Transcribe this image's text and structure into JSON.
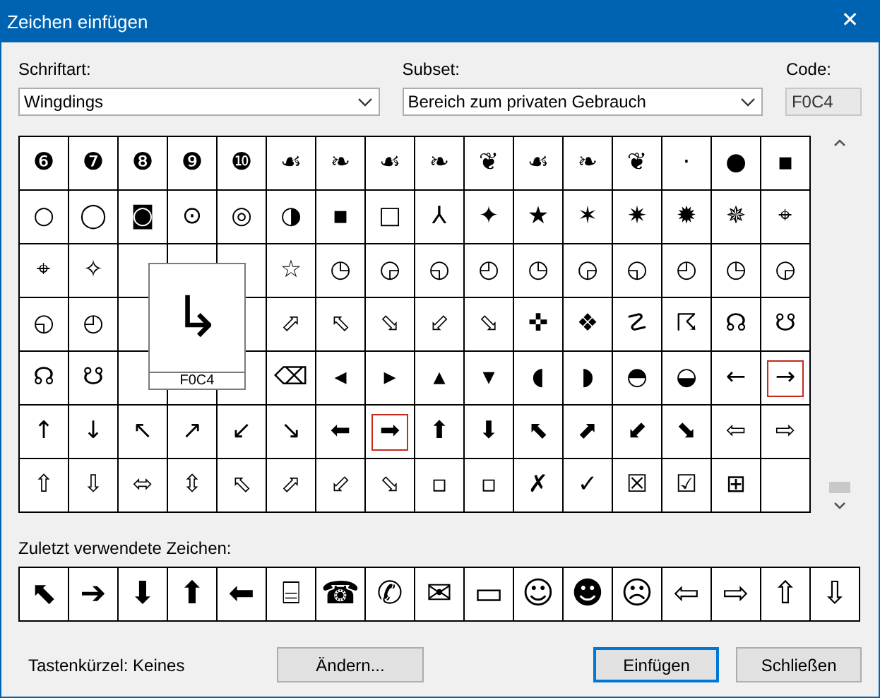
{
  "window": {
    "title": "Zeichen einfügen",
    "close": "✕"
  },
  "font": {
    "label": "Schriftart:",
    "value": "Wingdings"
  },
  "subset": {
    "label": "Subset:",
    "value": "Bereich zum privaten Gebrauch"
  },
  "code": {
    "label": "Code:",
    "value": "F0C4"
  },
  "grid": [
    {
      "cells": [
        {
          "symbol": "❻",
          "selected": false
        },
        {
          "symbol": "❼",
          "selected": false
        },
        {
          "symbol": "❽",
          "selected": false
        },
        {
          "symbol": "❾",
          "selected": false
        },
        {
          "symbol": "❿",
          "selected": false
        },
        {
          "symbol": "☙",
          "selected": false
        },
        {
          "symbol": "❧",
          "selected": false
        },
        {
          "symbol": "☙",
          "selected": false
        },
        {
          "symbol": "❧",
          "selected": false
        },
        {
          "symbol": "❦",
          "selected": false
        },
        {
          "symbol": "☙",
          "selected": false
        },
        {
          "symbol": "❧",
          "selected": false
        },
        {
          "symbol": "❦",
          "selected": false
        },
        {
          "symbol": "·",
          "selected": false
        },
        {
          "symbol": "●",
          "selected": false
        },
        {
          "symbol": "▪",
          "selected": false
        }
      ]
    },
    {
      "cells": [
        {
          "symbol": "○",
          "selected": false
        },
        {
          "symbol": "◯",
          "selected": false
        },
        {
          "symbol": "◙",
          "selected": false
        },
        {
          "symbol": "⊙",
          "selected": false
        },
        {
          "symbol": "◎",
          "selected": false
        },
        {
          "symbol": "◑",
          "selected": false
        },
        {
          "symbol": "▪",
          "selected": false
        },
        {
          "symbol": "□",
          "selected": false
        },
        {
          "symbol": "⅄",
          "selected": false
        },
        {
          "symbol": "✦",
          "selected": false
        },
        {
          "symbol": "★",
          "selected": false
        },
        {
          "symbol": "✶",
          "selected": false
        },
        {
          "symbol": "✷",
          "selected": false
        },
        {
          "symbol": "✹",
          "selected": false
        },
        {
          "symbol": "✵",
          "selected": false
        },
        {
          "symbol": "⌖",
          "selected": false
        }
      ]
    },
    {
      "cells": [
        {
          "symbol": "⌖",
          "selected": false
        },
        {
          "symbol": "✧",
          "selected": false
        }
      ],
      "after_preview": [
        {
          "symbol": "☆",
          "selected": false
        },
        {
          "symbol": "◷",
          "selected": false
        },
        {
          "symbol": "◶",
          "selected": false
        },
        {
          "symbol": "◵",
          "selected": false
        },
        {
          "symbol": "◴",
          "selected": false
        },
        {
          "symbol": "◷",
          "selected": false
        },
        {
          "symbol": "◶",
          "selected": false
        },
        {
          "symbol": "◵",
          "selected": false
        },
        {
          "symbol": "◴",
          "selected": false
        },
        {
          "symbol": "◷",
          "selected": false
        },
        {
          "symbol": "◶",
          "selected": false
        }
      ]
    },
    {
      "cells": [
        {
          "symbol": "◵",
          "selected": false
        },
        {
          "symbol": "◴",
          "selected": false
        }
      ],
      "after_preview": [
        {
          "symbol": "⬀",
          "selected": false
        },
        {
          "symbol": "⬁",
          "selected": false
        },
        {
          "symbol": "⬂",
          "selected": false
        },
        {
          "symbol": "⬃",
          "selected": false
        },
        {
          "symbol": "⬂",
          "selected": false
        },
        {
          "symbol": "✜",
          "selected": false
        },
        {
          "symbol": "❖",
          "selected": false
        },
        {
          "symbol": "☡",
          "selected": false
        },
        {
          "symbol": "☈",
          "selected": false
        },
        {
          "symbol": "☊",
          "selected": false
        },
        {
          "symbol": "☋",
          "selected": false
        }
      ]
    },
    {
      "cells": [
        {
          "symbol": "☊",
          "selected": false
        },
        {
          "symbol": "☋",
          "selected": false
        }
      ],
      "after_preview": [
        {
          "symbol": "⌫",
          "selected": false
        },
        {
          "symbol": "◂",
          "selected": false
        },
        {
          "symbol": "▸",
          "selected": false
        },
        {
          "symbol": "▴",
          "selected": false
        },
        {
          "symbol": "▾",
          "selected": false
        },
        {
          "symbol": "◖",
          "selected": false
        },
        {
          "symbol": "◗",
          "selected": false
        },
        {
          "symbol": "◓",
          "selected": false
        },
        {
          "symbol": "◒",
          "selected": false
        },
        {
          "symbol": "←",
          "selected": false
        },
        {
          "symbol": "→",
          "selected": true
        }
      ]
    },
    {
      "cells": [
        {
          "symbol": "↑",
          "selected": false
        },
        {
          "symbol": "↓",
          "selected": false
        },
        {
          "symbol": "↖",
          "selected": false
        },
        {
          "symbol": "↗",
          "selected": false
        },
        {
          "symbol": "↙",
          "selected": false
        },
        {
          "symbol": "↘",
          "selected": false
        },
        {
          "symbol": "⬅",
          "selected": false
        },
        {
          "symbol": "➡",
          "selected": true
        },
        {
          "symbol": "⬆",
          "selected": false
        },
        {
          "symbol": "⬇",
          "selected": false
        },
        {
          "symbol": "⬉",
          "selected": false
        },
        {
          "symbol": "⬈",
          "selected": false
        },
        {
          "symbol": "⬋",
          "selected": false
        },
        {
          "symbol": "⬊",
          "selected": false
        },
        {
          "symbol": "⇦",
          "selected": false
        },
        {
          "symbol": "⇨",
          "selected": false
        }
      ]
    },
    {
      "cells": [
        {
          "symbol": "⇧",
          "selected": false
        },
        {
          "symbol": "⇩",
          "selected": false
        },
        {
          "symbol": "⬄",
          "selected": false
        },
        {
          "symbol": "⇳",
          "selected": false
        },
        {
          "symbol": "⬁",
          "selected": false
        },
        {
          "symbol": "⬀",
          "selected": false
        },
        {
          "symbol": "⬃",
          "selected": false
        },
        {
          "symbol": "⬂",
          "selected": false
        },
        {
          "symbol": "▫",
          "selected": false
        },
        {
          "symbol": "▫",
          "selected": false
        },
        {
          "symbol": "✗",
          "selected": false
        },
        {
          "symbol": "✓",
          "selected": false
        },
        {
          "symbol": "☒",
          "selected": false
        },
        {
          "symbol": "☑",
          "selected": false
        },
        {
          "symbol": "⊞",
          "selected": false
        }
      ]
    }
  ],
  "preview": {
    "symbol": "↳",
    "code": "F0C4"
  },
  "recent": {
    "label": "Zuletzt verwendete Zeichen:",
    "symbols": [
      "⬉",
      "➔",
      "⬇",
      "⬆",
      "⬅",
      "⌸",
      "☎",
      "✆",
      "✉",
      "▭",
      "☺",
      "☻",
      "☹",
      "⇦",
      "⇨",
      "⇧",
      "⇩"
    ]
  },
  "shortcut": "Tastenkürzel: Keines",
  "buttons": [
    {
      "label": "Ändern...",
      "default": false
    },
    {
      "label": "Einfügen",
      "default": true
    },
    {
      "label": "Schließen",
      "default": false
    }
  ]
}
